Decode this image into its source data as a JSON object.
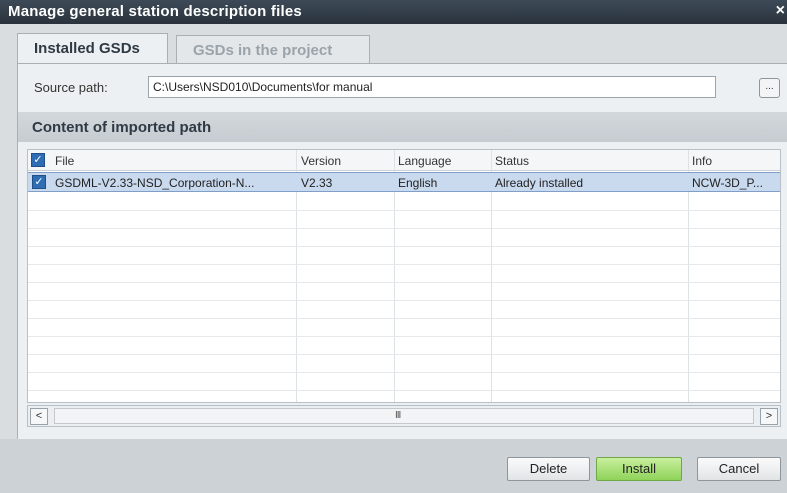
{
  "dialog": {
    "title": "Manage general station description files",
    "close_glyph": "×"
  },
  "tabs": [
    {
      "label": "Installed GSDs",
      "active": true
    },
    {
      "label": "GSDs in the project",
      "active": false
    }
  ],
  "source": {
    "label": "Source path:",
    "value": "C:\\Users\\NSD010\\Documents\\for manual",
    "browse_label": "..."
  },
  "content": {
    "title": "Content of imported path",
    "columns": [
      "File",
      "Version",
      "Language",
      "Status",
      "Info"
    ],
    "rows": [
      {
        "checked": true,
        "file": "GSDML-V2.33-NSD_Corporation-N...",
        "version": "V2.33",
        "language": "English",
        "status": "Already installed",
        "info": "NCW-3D_P..."
      }
    ]
  },
  "scrollbar": {
    "left_glyph": "<",
    "right_glyph": ">",
    "grip": "III"
  },
  "buttons": {
    "delete": "Delete",
    "install": "Install",
    "cancel": "Cancel"
  },
  "colors": {
    "titlebar": "#2a333c",
    "selection": "#c9d9ee",
    "install_button": "#8fd35a",
    "checkbox": "#2e6db4"
  },
  "icons": {
    "checkbox_checked": "checkbox-checked-icon"
  }
}
